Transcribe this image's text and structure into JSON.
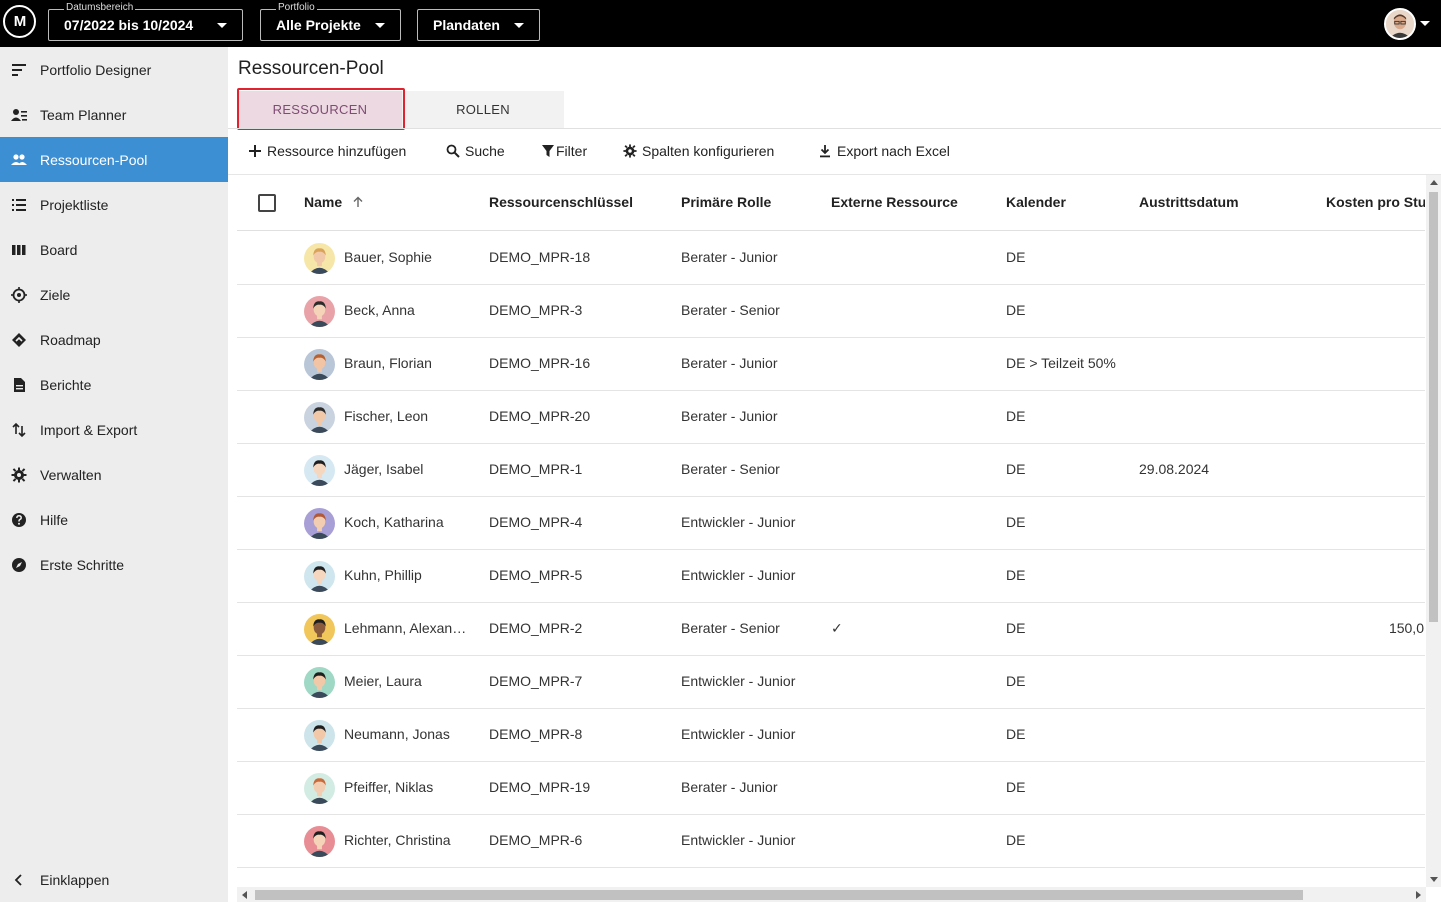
{
  "topbar": {
    "logo_text": "M",
    "date_range": {
      "caption": "Datumsbereich",
      "value": "07/2022 bis 10/2024"
    },
    "portfolio": {
      "caption": "Portfolio",
      "value": "Alle Projekte"
    },
    "data_type": {
      "value": "Plandaten"
    }
  },
  "sidebar": {
    "items": [
      {
        "label": "Portfolio Designer",
        "icon": "sort-lines-icon"
      },
      {
        "label": "Team Planner",
        "icon": "person-list-icon"
      },
      {
        "label": "Ressourcen-Pool",
        "icon": "people-icon",
        "active": true
      },
      {
        "label": "Projektliste",
        "icon": "list-icon"
      },
      {
        "label": "Board",
        "icon": "columns-icon"
      },
      {
        "label": "Ziele",
        "icon": "target-icon"
      },
      {
        "label": "Roadmap",
        "icon": "diamond-icon"
      },
      {
        "label": "Berichte",
        "icon": "document-icon"
      },
      {
        "label": "Import & Export",
        "icon": "swap-icon"
      },
      {
        "label": "Verwalten",
        "icon": "gear-icon"
      },
      {
        "label": "Hilfe",
        "icon": "help-icon"
      },
      {
        "label": "Erste Schritte",
        "icon": "compass-icon"
      }
    ],
    "collapse_label": "Einklappen"
  },
  "page": {
    "title": "Ressourcen-Pool",
    "tabs": [
      {
        "label": "RESSOURCEN",
        "active": true
      },
      {
        "label": "ROLLEN"
      }
    ]
  },
  "toolbar": {
    "add": "Ressource hinzufügen",
    "search": "Suche",
    "filter": "Filter",
    "columns": "Spalten konfigurieren",
    "export": "Export nach Excel"
  },
  "table": {
    "columns": [
      "Name",
      "Ressourcenschlüssel",
      "Primäre Rolle",
      "Externe Ressource",
      "Kalender",
      "Austrittsdatum",
      "Kosten pro Stur"
    ],
    "sorted_column": "Name",
    "sort_direction": "ascending",
    "rows": [
      {
        "name": "Bauer, Sophie",
        "key": "DEMO_MPR-18",
        "role": "Berater - Junior",
        "external": "",
        "calendar": "DE",
        "exit": "",
        "cost": "",
        "avatar_bg": "#f6e7a8",
        "hair": "#d9a35a",
        "skin": "#f2c9a8"
      },
      {
        "name": "Beck, Anna",
        "key": "DEMO_MPR-3",
        "role": "Berater - Senior",
        "external": "",
        "calendar": "DE",
        "exit": "",
        "cost": "",
        "avatar_bg": "#e9a3a8",
        "hair": "#2b2b2b",
        "skin": "#f5d3b8"
      },
      {
        "name": "Braun, Florian",
        "key": "DEMO_MPR-16",
        "role": "Berater - Junior",
        "external": "",
        "calendar": "DE > Teilzeit 50%",
        "exit": "",
        "cost": "",
        "avatar_bg": "#b9c6d8",
        "hair": "#b8612f",
        "skin": "#f0c4a4"
      },
      {
        "name": "Fischer, Leon",
        "key": "DEMO_MPR-20",
        "role": "Berater - Junior",
        "external": "",
        "calendar": "DE",
        "exit": "",
        "cost": "",
        "avatar_bg": "#c9d3e0",
        "hair": "#2b2b2b",
        "skin": "#f1c9a9"
      },
      {
        "name": "Jäger, Isabel",
        "key": "DEMO_MPR-1",
        "role": "Berater - Senior",
        "external": "",
        "calendar": "DE",
        "exit": "29.08.2024",
        "cost": "",
        "avatar_bg": "#d6e9f2",
        "hair": "#1f1f1f",
        "skin": "#f5d6be"
      },
      {
        "name": "Koch, Katharina",
        "key": "DEMO_MPR-4",
        "role": "Entwickler - Junior",
        "external": "",
        "calendar": "DE",
        "exit": "",
        "cost": "",
        "avatar_bg": "#a89fd6",
        "hair": "#b05a3a",
        "skin": "#f3cdb2"
      },
      {
        "name": "Kuhn, Phillip",
        "key": "DEMO_MPR-5",
        "role": "Entwickler - Junior",
        "external": "",
        "calendar": "DE",
        "exit": "",
        "cost": "",
        "avatar_bg": "#cfe6ef",
        "hair": "#1f1f1f",
        "skin": "#f5d6be"
      },
      {
        "name": "Lehmann, Alexan…",
        "key": "DEMO_MPR-2",
        "role": "Berater - Senior",
        "external": "✓",
        "calendar": "DE",
        "exit": "",
        "cost": "150,0",
        "avatar_bg": "#f1c75b",
        "hair": "#1f1f1f",
        "skin": "#8a5a3c"
      },
      {
        "name": "Meier, Laura",
        "key": "DEMO_MPR-7",
        "role": "Entwickler - Junior",
        "external": "",
        "calendar": "DE",
        "exit": "",
        "cost": "",
        "avatar_bg": "#9fd8c4",
        "hair": "#1f1f1f",
        "skin": "#f2c9a8"
      },
      {
        "name": "Neumann, Jonas",
        "key": "DEMO_MPR-8",
        "role": "Entwickler - Junior",
        "external": "",
        "calendar": "DE",
        "exit": "",
        "cost": "",
        "avatar_bg": "#cde4ea",
        "hair": "#1f1f1f",
        "skin": "#f1c9a9"
      },
      {
        "name": "Pfeiffer, Niklas",
        "key": "DEMO_MPR-19",
        "role": "Berater - Junior",
        "external": "",
        "calendar": "DE",
        "exit": "",
        "cost": "",
        "avatar_bg": "#d3ece3",
        "hair": "#c96a3a",
        "skin": "#f3cdb2"
      },
      {
        "name": "Richter, Christina",
        "key": "DEMO_MPR-6",
        "role": "Entwickler - Junior",
        "external": "",
        "calendar": "DE",
        "exit": "",
        "cost": "",
        "avatar_bg": "#e98d95",
        "hair": "#1f1f1f",
        "skin": "#f5d3b8"
      }
    ]
  },
  "colors": {
    "topbar": "#000000",
    "sidebar": "#ededed",
    "active_nav": "#3d8fd4",
    "active_tab_bg": "#ecd9e1",
    "active_tab_text": "#7f4c74",
    "highlight_outline": "#e0232e"
  }
}
